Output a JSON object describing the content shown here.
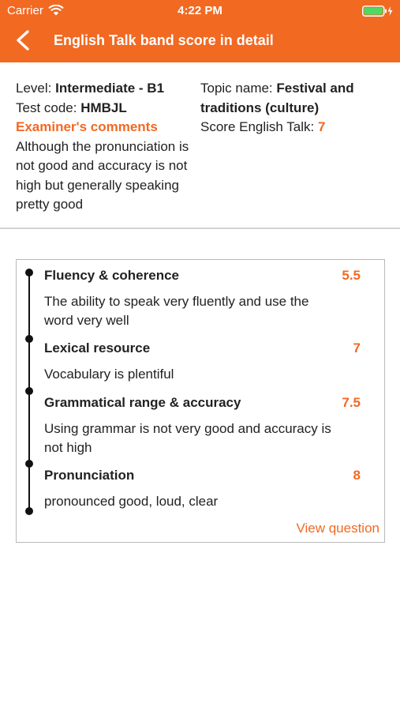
{
  "status": {
    "carrier": "Carrier",
    "time": "4:22 PM"
  },
  "nav": {
    "title": "English Talk band score in detail"
  },
  "info": {
    "level_label": "Level: ",
    "level_value": "Intermediate - B1",
    "test_code_label": "Test code: ",
    "test_code_value": "HMBJL",
    "examiner_title": "Examiner's comments",
    "comment": "Although the pronunciation is not good and accuracy is not high but generally speaking pretty good",
    "topic_label": "Topic name: ",
    "topic_value": "Festival and traditions (culture)",
    "score_label": "Score English Talk: ",
    "score_value": "7"
  },
  "criteria": [
    {
      "name": "Fluency & coherence",
      "score": "5.5",
      "description": "The ability to speak very fluently and use the word very well"
    },
    {
      "name": "Lexical resource",
      "score": "7",
      "description": "Vocabulary is plentiful"
    },
    {
      "name": "Grammatical range & accuracy",
      "score": "7.5",
      "description": "Using grammar is not very good and accuracy is not high"
    },
    {
      "name": "Pronunciation",
      "score": "8",
      "description": "pronounced good, loud, clear"
    }
  ],
  "view_question_label": "View question",
  "colors": {
    "accent": "#f26922",
    "text": "#222222",
    "border": "#b9b9b9"
  },
  "icons": {
    "back": "chevron-left-icon",
    "wifi": "wifi-icon",
    "battery": "battery-icon"
  }
}
